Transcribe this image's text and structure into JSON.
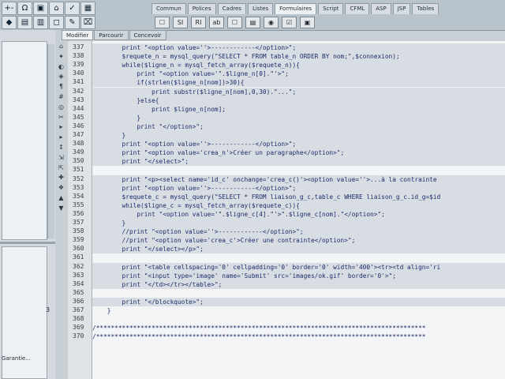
{
  "toolbar_left": {
    "buttons": [
      "+-",
      "Ω",
      "▣",
      "⌂",
      "✓",
      "▦",
      "◆",
      "▤",
      "▥",
      "◻",
      "✎",
      "⌧"
    ]
  },
  "insert_tabs": [
    "Commun",
    "Polices",
    "Cadres",
    "Listes",
    "Formulaires",
    "Script",
    "CFML",
    "ASP",
    "JSP",
    "Tables"
  ],
  "active_insert_tab": "Formulaires",
  "form_tools": [
    "☐",
    "SI",
    "RI",
    "ab",
    "☐",
    "▤",
    "◉",
    "☑",
    "▣"
  ],
  "view_tabs": [
    "Modifier",
    "Parcourir",
    "Concevoir"
  ],
  "active_view_tab": "Modifier",
  "left_panel": {
    "number": "3",
    "label": "Garantie..."
  },
  "icon_strip": [
    "⌂",
    "✦",
    "◐",
    "◈",
    "¶",
    "#",
    "◎",
    "✂",
    "▸",
    "▸",
    "↕",
    "⇲",
    "⇱",
    "✚",
    "❖",
    "▲",
    "▼"
  ],
  "lines": [
    {
      "n": "337",
      "t": "        print \"<option value=''>------------</option>\";"
    },
    {
      "n": "338",
      "t": "        $requete_n = mysql_query(\"SELECT * FROM table_n ORDER BY nom;\",$connexion);"
    },
    {
      "n": "339",
      "t": "        while($ligne_n = mysql_fetch_array($requete_n)){"
    },
    {
      "n": "340",
      "t": "            print \"<option value='\".$ligne_n[0].\"'>\";"
    },
    {
      "n": "341",
      "t": "            if(strlen($ligne_n[nom])>30){"
    },
    {
      "n": "342",
      "t": "                print substr($ligne_n[nom],0,30).\"...\";"
    },
    {
      "n": "343",
      "t": "            }else{"
    },
    {
      "n": "344",
      "t": "                print $ligne_n[nom];"
    },
    {
      "n": "345",
      "t": "            }"
    },
    {
      "n": "346",
      "t": "            print \"</option>\";"
    },
    {
      "n": "347",
      "t": "        }"
    },
    {
      "n": "348",
      "t": "        print \"<option value=''>------------</option>\";"
    },
    {
      "n": "349",
      "t": "        print \"<option value='crea_n'>Créer un paragraphe</option>\";"
    },
    {
      "n": "350",
      "t": "        print \"</select>\";"
    },
    {
      "n": "351",
      "t": ""
    },
    {
      "n": "352",
      "t": "        print \"<p><select name='id_c' onchange='crea_c()'><option value=''>...à la contrainte"
    },
    {
      "n": "353",
      "t": "        print \"<option value=''>------------</option>\";"
    },
    {
      "n": "354",
      "t": "        $requete_c = mysql_query(\"SELECT * FROM liaison_g_c,table_c WHERE liaison_g_c.id_g=$id"
    },
    {
      "n": "355",
      "t": "        while($ligne_c = mysql_fetch_array($requete_c)){"
    },
    {
      "n": "356",
      "t": "            print \"<option value='\".$ligne_c[4].\"'>\".$ligne_c[nom].\"</option>\";"
    },
    {
      "n": "357",
      "t": "        }"
    },
    {
      "n": "358",
      "t": "        //print \"<option value=''>------------</option>\";"
    },
    {
      "n": "359",
      "t": "        //print \"<option value='crea_c'>Créer une contrainte</option>\";"
    },
    {
      "n": "360",
      "t": "        print \"</select></p>\";"
    },
    {
      "n": "361",
      "t": ""
    },
    {
      "n": "362",
      "t": "        print \"<table cellspacing='0' cellpadding='0' border='0' width='400'><tr><td align='ri"
    },
    {
      "n": "363",
      "t": "        print \"<input type='image' name='Submit' src='images/ok.gif' border='0'>\";"
    },
    {
      "n": "364",
      "t": "        print \"</td></tr></table>\";"
    },
    {
      "n": "365",
      "t": ""
    },
    {
      "n": "366",
      "t": "        print \"</blockquote>\";"
    },
    {
      "n": "367",
      "t": "    }"
    },
    {
      "n": "368",
      "t": ""
    },
    {
      "n": "369",
      "t": "/*****************************************************************************************"
    },
    {
      "n": "370",
      "t": "/*****************************************************************************************"
    }
  ],
  "highlighted_lines": [
    "337",
    "338",
    "339",
    "340",
    "341",
    "342",
    "343",
    "344",
    "345",
    "346",
    "347",
    "348",
    "349",
    "350",
    "352",
    "353",
    "354",
    "355",
    "356",
    "357",
    "358",
    "359",
    "360",
    "362",
    "363",
    "364",
    "366"
  ]
}
